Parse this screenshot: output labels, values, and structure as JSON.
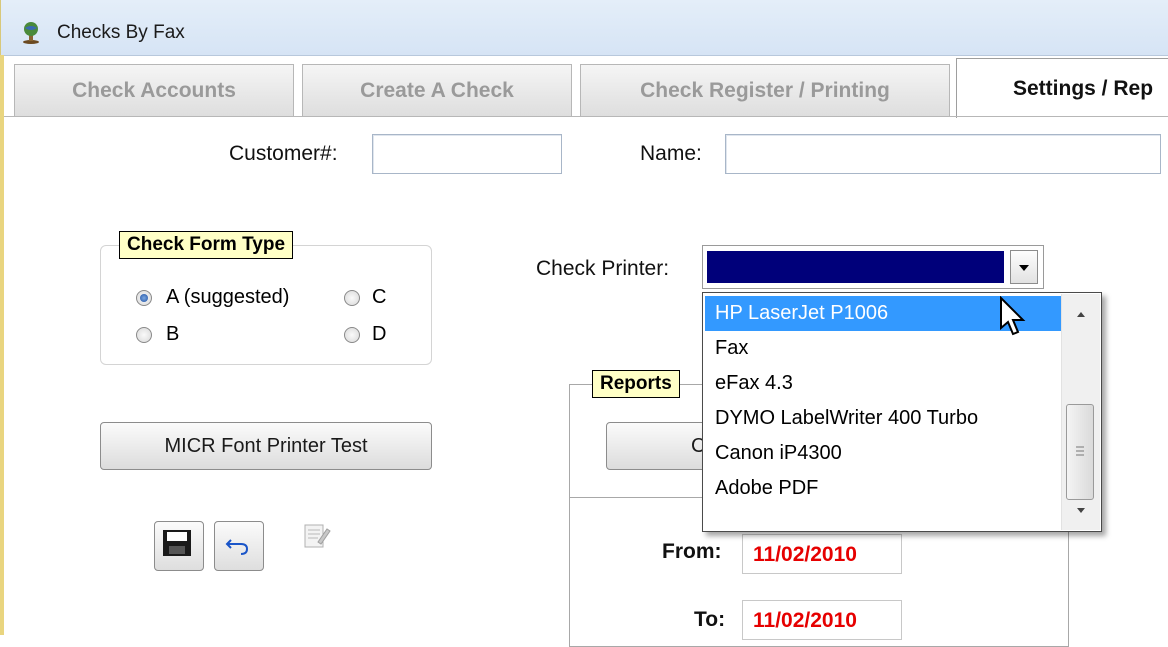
{
  "window": {
    "title": "Checks By Fax",
    "icon": "globe-icon"
  },
  "tabs": [
    {
      "label": "Check Accounts"
    },
    {
      "label": "Create A Check"
    },
    {
      "label": "Check Register / Printing"
    },
    {
      "label": "Settings / Rep"
    }
  ],
  "customer": {
    "label": "Customer#:",
    "value": ""
  },
  "name": {
    "label": "Name:",
    "value": ""
  },
  "check_form_type": {
    "title": "Check Form Type",
    "options": [
      "A (suggested)",
      "B",
      "C",
      "D"
    ],
    "selected": "A (suggested)"
  },
  "check_printer": {
    "label": "Check Printer:",
    "selected_option": "HP LaserJet P1006",
    "options": [
      "HP LaserJet P1006",
      "Fax",
      "eFax 4.3",
      "DYMO LabelWriter 400 Turbo",
      "Canon iP4300",
      "Adobe PDF"
    ]
  },
  "buttons": {
    "micr_test": "MICR Font Printer Test",
    "reports_partial": "C"
  },
  "reports": {
    "title": "Reports"
  },
  "dates": {
    "from_label": "From:",
    "from_value": "11/02/2010",
    "to_label": "To:",
    "to_value": "11/02/2010"
  },
  "colors": {
    "selection": "#3399ff",
    "combo_selected": "#00007a",
    "date_text": "#e60000",
    "legend_bg": "#ffffc6"
  }
}
